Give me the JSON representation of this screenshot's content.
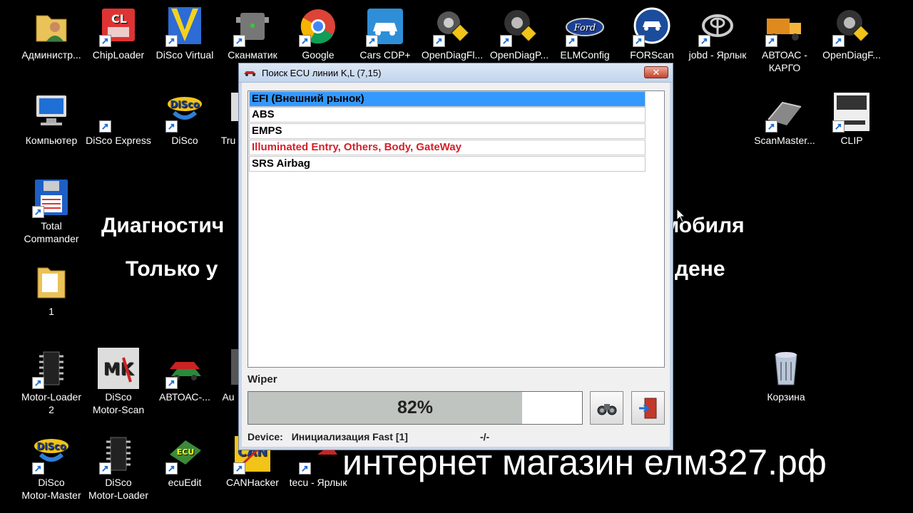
{
  "desktop": {
    "icons": [
      {
        "label": "Администр...",
        "icon": "user-folder-icon"
      },
      {
        "label": "ChipLoader",
        "icon": "chiploader-icon"
      },
      {
        "label": "DiSco Virtual",
        "icon": "disco-virtual-icon"
      },
      {
        "label": "Сканматик",
        "icon": "scanmatik-icon"
      },
      {
        "label": "Google",
        "icon": "chrome-icon"
      },
      {
        "label": "Cars CDP+",
        "icon": "car-icon"
      },
      {
        "label": "OpenDiagFl...",
        "icon": "opendiag-icon"
      },
      {
        "label": "OpenDiagP...",
        "icon": "opendiag-icon"
      },
      {
        "label": "ELMConfig",
        "icon": "ford-icon"
      },
      {
        "label": "FORScan",
        "icon": "forscan-icon"
      },
      {
        "label": "jobd - Ярлык",
        "icon": "toyota-icon"
      },
      {
        "label": "АВТОАС -\nКАРГО",
        "icon": "truck-icon"
      },
      {
        "label": "OpenDiagF...",
        "icon": "opendiag-icon"
      },
      {
        "label": "Компьютер",
        "icon": "computer-icon"
      },
      {
        "label": "DiSco Express",
        "icon": "disco-express-icon"
      },
      {
        "label": "DiSco",
        "icon": "disco-icon"
      },
      {
        "label": "Tru",
        "icon": "app-icon"
      },
      {
        "label": "ScanMaster...",
        "icon": "scanmaster-icon"
      },
      {
        "label": "CLIP",
        "icon": "clip-icon"
      },
      {
        "label": "Total\nCommander",
        "icon": "floppy-icon"
      },
      {
        "label": "1",
        "icon": "folder-icon"
      },
      {
        "label": "Motor-Loader\n2",
        "icon": "chip-icon"
      },
      {
        "label": "DiSco\nMotor-Scan",
        "icon": "motor-scan-icon"
      },
      {
        "label": "АВТОАС-...",
        "icon": "cars-icon"
      },
      {
        "label": "Au",
        "icon": "app-icon"
      },
      {
        "label": "Корзина",
        "icon": "recycle-bin-icon"
      },
      {
        "label": "DiSco\nMotor-Master",
        "icon": "disco-icon"
      },
      {
        "label": "DiSco\nMotor-Loader",
        "icon": "chip-icon"
      },
      {
        "label": "ecuEdit",
        "icon": "ecu-icon"
      },
      {
        "label": "CANHacker",
        "icon": "canhacker-icon"
      },
      {
        "label": "tecu - Ярлык",
        "icon": "car-red-icon"
      }
    ]
  },
  "overlay": {
    "line1_left": "Диагностич",
    "line1_right": "мобиля",
    "line2_left": "Только у",
    "line2_right": "дене",
    "shop": "интернет магазин елм327.рф"
  },
  "dialog": {
    "title": "Поиск ECU линии K,L (7,15)",
    "close_label": "✕",
    "ecu_items": [
      {
        "label": "EFI (Внешний рынок)",
        "selected": true,
        "color": "#000000"
      },
      {
        "label": "ABS",
        "selected": false,
        "color": "#000000"
      },
      {
        "label": "EMPS",
        "selected": false,
        "color": "#000000"
      },
      {
        "label": "Illuminated Entry, Others, Body, GateWay",
        "selected": false,
        "color": "#d4202a"
      },
      {
        "label": "SRS Airbag",
        "selected": false,
        "color": "#000000"
      }
    ],
    "current_module": "Wiper",
    "progress_text": "82%",
    "progress_value": 0.82,
    "status_label": "Device:",
    "status_value": "Инициализация Fast [1]",
    "status_spinner": "-/-",
    "find_icon": "binoculars-icon",
    "exit_icon": "exit-door-icon"
  },
  "colors": {
    "selection": "#3399ff",
    "highlight_text": "#d4202a"
  }
}
